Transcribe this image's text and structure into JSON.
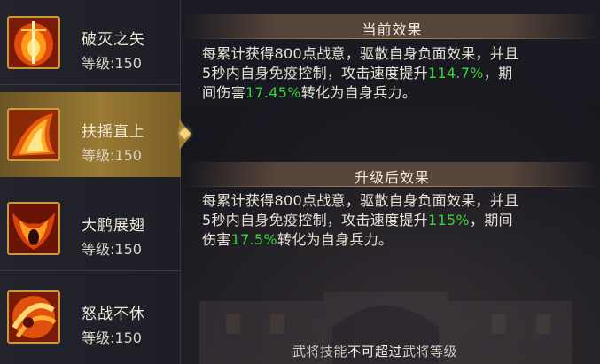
{
  "skills": [
    {
      "name": "破灭之矢",
      "level": "等级:150",
      "icon": "fire-arrow-icon",
      "selected": false
    },
    {
      "name": "扶摇直上",
      "level": "等级:150",
      "icon": "fire-rise-icon",
      "selected": true
    },
    {
      "name": "大鹏展翅",
      "level": "等级:150",
      "icon": "fire-wings-icon",
      "selected": false
    },
    {
      "name": "怒战不休",
      "level": "等级:150",
      "icon": "fire-rage-icon",
      "selected": false
    }
  ],
  "current": {
    "title": "当前效果",
    "line1": "每累计获得800点战意，驱散自身负面效果，并且",
    "line2_pre": "5秒内自身免疫控制，攻击速度提升",
    "line2_val": "114.7%",
    "line2_post": "，期",
    "line3_pre": "间伤害",
    "line3_val": "17.45%",
    "line3_post": "转化为自身兵力。"
  },
  "upgraded": {
    "title": "升级后效果",
    "line1": "每累计获得800点战意，驱散自身负面效果，并且",
    "line2_pre": "5秒内自身免疫控制，攻击速度提升",
    "line2_val": "115%",
    "line2_post": "，期间",
    "line3_pre": "伤害",
    "line3_val": "17.5%",
    "line3_post": "转化为自身兵力。"
  },
  "footer": {
    "part1": "武将技能",
    "part2": "不可超过",
    "part3": "武将等级"
  },
  "colors": {
    "highlight_green": "#38d33a",
    "gold": "#9a7a34"
  }
}
